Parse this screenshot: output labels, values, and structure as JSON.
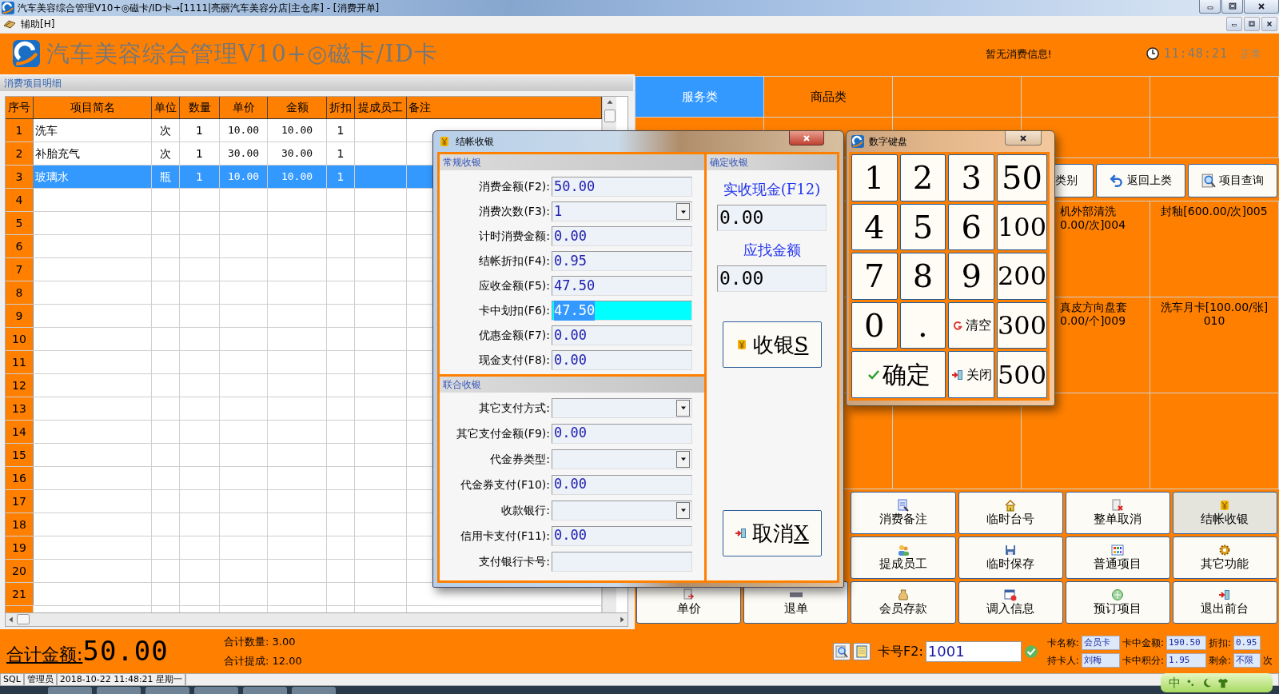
{
  "window": {
    "title": "汽车美容综合管理V10+◎磁卡/ID卡→[1111|亮丽汽车美容分店|主仓库] - [消费开单]"
  },
  "menu": [
    {
      "label": "辅助[H]"
    }
  ],
  "header": {
    "title": "汽车美容综合管理V10+◎磁卡/ID卡",
    "message": "暂无消费信息!",
    "time": "11:48:21",
    "status": "正常"
  },
  "detail": {
    "title": "消费项目明细",
    "columns": [
      "序号",
      "项目简名",
      "单位",
      "数量",
      "单价",
      "金额",
      "折扣",
      "提成员工",
      "备注"
    ],
    "rows": [
      {
        "no": "1",
        "name": "洗车",
        "unit": "次",
        "qty": "1",
        "price": "10.00",
        "amount": "10.00",
        "discount": "1",
        "selected": false
      },
      {
        "no": "2",
        "name": "补胎充气",
        "unit": "次",
        "qty": "1",
        "price": "30.00",
        "amount": "30.00",
        "discount": "1",
        "selected": false
      },
      {
        "no": "3",
        "name": "玻璃水",
        "unit": "瓶",
        "qty": "1",
        "price": "10.00",
        "amount": "10.00",
        "discount": "1",
        "selected": true
      },
      {
        "no": "4",
        "selected": false
      },
      {
        "no": "5",
        "selected": false
      },
      {
        "no": "6",
        "selected": false
      },
      {
        "no": "7",
        "selected": false
      },
      {
        "no": "8",
        "selected": false
      },
      {
        "no": "9",
        "selected": false
      },
      {
        "no": "10",
        "selected": false
      },
      {
        "no": "11",
        "selected": false
      },
      {
        "no": "12",
        "selected": false
      },
      {
        "no": "13",
        "selected": false
      },
      {
        "no": "14",
        "selected": false
      },
      {
        "no": "15",
        "selected": false
      },
      {
        "no": "16",
        "selected": false
      },
      {
        "no": "17",
        "selected": false
      },
      {
        "no": "18",
        "selected": false
      },
      {
        "no": "19",
        "selected": false
      },
      {
        "no": "20",
        "selected": false
      },
      {
        "no": "21",
        "selected": false
      }
    ]
  },
  "categories": [
    {
      "label": "服务类",
      "selected": true
    },
    {
      "label": "商品类",
      "selected": false
    }
  ],
  "toolbar": [
    {
      "label": "类别",
      "kind": "plain"
    },
    {
      "label": "返回上类",
      "kind": "back"
    },
    {
      "label": "项目查询",
      "kind": "search"
    }
  ],
  "items": [
    {
      "lines": [
        "机外部清洗",
        "0.00/次]004"
      ],
      "clipped": true
    },
    {
      "lines": [
        "封釉[600.00/次]005"
      ],
      "clipped": false
    },
    {
      "lines": [
        "真皮方向盘套",
        "0.00/个]009"
      ],
      "clipped": true
    },
    {
      "lines": [
        "洗车月卡[100.00/张]",
        "010"
      ],
      "clipped": false
    }
  ],
  "functions": [
    {
      "label": "消费备注",
      "kind": "note",
      "selected": false
    },
    {
      "label": "临时台号",
      "kind": "house",
      "selected": false
    },
    {
      "label": "整单取消",
      "kind": "cancel",
      "selected": false
    },
    {
      "label": "结帐收银",
      "kind": "yuan",
      "selected": true
    },
    {
      "label": "提成员工",
      "kind": "people",
      "selected": false
    },
    {
      "label": "临时保存",
      "kind": "disk",
      "selected": false
    },
    {
      "label": "普通项目",
      "kind": "grid",
      "selected": false
    },
    {
      "label": "其它功能",
      "kind": "gear",
      "selected": false
    },
    {
      "label": "单价",
      "kind": "price",
      "selected": false
    },
    {
      "label": "退单",
      "kind": "minus",
      "selected": false
    },
    {
      "label": "会员存款",
      "kind": "bag",
      "selected": false
    },
    {
      "label": "调入信息",
      "kind": "calendar",
      "selected": false
    },
    {
      "label": "预订项目",
      "kind": "globe",
      "selected": false
    },
    {
      "label": "退出前台",
      "kind": "exit",
      "selected": false
    }
  ],
  "totals": {
    "amount_label": "合计金额:",
    "amount": "50.00",
    "qty_label": "合计数量:",
    "qty": "3.00",
    "commission_label": "合计提成:",
    "commission": "12.00"
  },
  "card": {
    "label": "卡号F2:",
    "number": "1001",
    "fields": [
      {
        "label": "卡名称:",
        "value": "会员卡"
      },
      {
        "label": "卡中金额:",
        "value": "190.50"
      },
      {
        "label": "折扣:",
        "value": "0.95"
      },
      {
        "label": "持卡人:",
        "value": "刘梅"
      },
      {
        "label": "卡中积分:",
        "value": "1.95"
      },
      {
        "label": "剩余:",
        "value": "不限",
        "suffix": "次"
      }
    ]
  },
  "status_bar": [
    "SQL",
    "管理员",
    "2018-10-22 11:48:21 星期一"
  ],
  "ime": {
    "label": "中"
  },
  "checkout_dialog": {
    "title": "结帐收银",
    "regular": {
      "title": "常规收银",
      "fields": [
        {
          "label": "消费金额(F2):",
          "value": "50.00",
          "kind": "text",
          "focused": false
        },
        {
          "label": "消费次数(F3):",
          "value": "1",
          "kind": "select",
          "focused": false
        },
        {
          "label": "计时消费金额:",
          "value": "0.00",
          "kind": "text",
          "focused": false
        },
        {
          "label": "结帐折扣(F4):",
          "value": "0.95",
          "kind": "text",
          "focused": false
        },
        {
          "label": "应收金额(F5):",
          "value": "47.50",
          "kind": "text",
          "focused": false
        },
        {
          "label": "卡中划扣(F6):",
          "value": "47.50",
          "kind": "text",
          "focused": true
        },
        {
          "label": "优惠金额(F7):",
          "value": "0.00",
          "kind": "text",
          "focused": false
        },
        {
          "label": "现金支付(F8):",
          "value": "0.00",
          "kind": "text",
          "focused": false
        }
      ]
    },
    "combined": {
      "title": "联合收银",
      "fields": [
        {
          "label": "其它支付方式:",
          "kind": "select",
          "focused": false
        },
        {
          "label": "其它支付金额(F9):",
          "value": "0.00",
          "kind": "text",
          "focused": false
        },
        {
          "label": "代金券类型:",
          "kind": "select",
          "focused": false
        },
        {
          "label": "代金券支付(F10):",
          "value": "0.00",
          "kind": "text",
          "focused": false
        },
        {
          "label": "收款银行:",
          "kind": "select",
          "focused": false
        },
        {
          "label": "信用卡支付(F11):",
          "value": "0.00",
          "kind": "text",
          "focused": false
        },
        {
          "label": "支付银行卡号:",
          "kind": "text",
          "focused": false
        }
      ]
    },
    "confirm": {
      "title": "确定收银",
      "cash_label": "实收现金(F12)",
      "cash": "0.00",
      "change_label": "应找金额",
      "change": "0.00",
      "buttons": [
        {
          "label": "收银",
          "hotkey": "S",
          "kind": "yuan"
        },
        {
          "label": "取消",
          "hotkey": "X",
          "kind": "exit"
        }
      ]
    }
  },
  "keypad": {
    "title": "数字键盘",
    "keys": [
      {
        "label": "1",
        "kind": "digit"
      },
      {
        "label": "2",
        "kind": "digit"
      },
      {
        "label": "3",
        "kind": "digit"
      },
      {
        "label": "50",
        "kind": "digit"
      },
      {
        "label": "4",
        "kind": "digit"
      },
      {
        "label": "5",
        "kind": "digit"
      },
      {
        "label": "6",
        "kind": "digit"
      },
      {
        "label": "100",
        "kind": "digit"
      },
      {
        "label": "7",
        "kind": "digit"
      },
      {
        "label": "8",
        "kind": "digit"
      },
      {
        "label": "9",
        "kind": "digit"
      },
      {
        "label": "200",
        "kind": "digit"
      },
      {
        "label": "0",
        "kind": "digit"
      },
      {
        "label": ".",
        "kind": "digit"
      },
      {
        "label": "清空",
        "kind": "clear"
      },
      {
        "label": "300",
        "kind": "digit"
      },
      {
        "label": "确定",
        "kind": "ok"
      },
      {
        "label": "关闭",
        "kind": "close"
      },
      {
        "label": "500",
        "kind": "digit"
      }
    ]
  }
}
